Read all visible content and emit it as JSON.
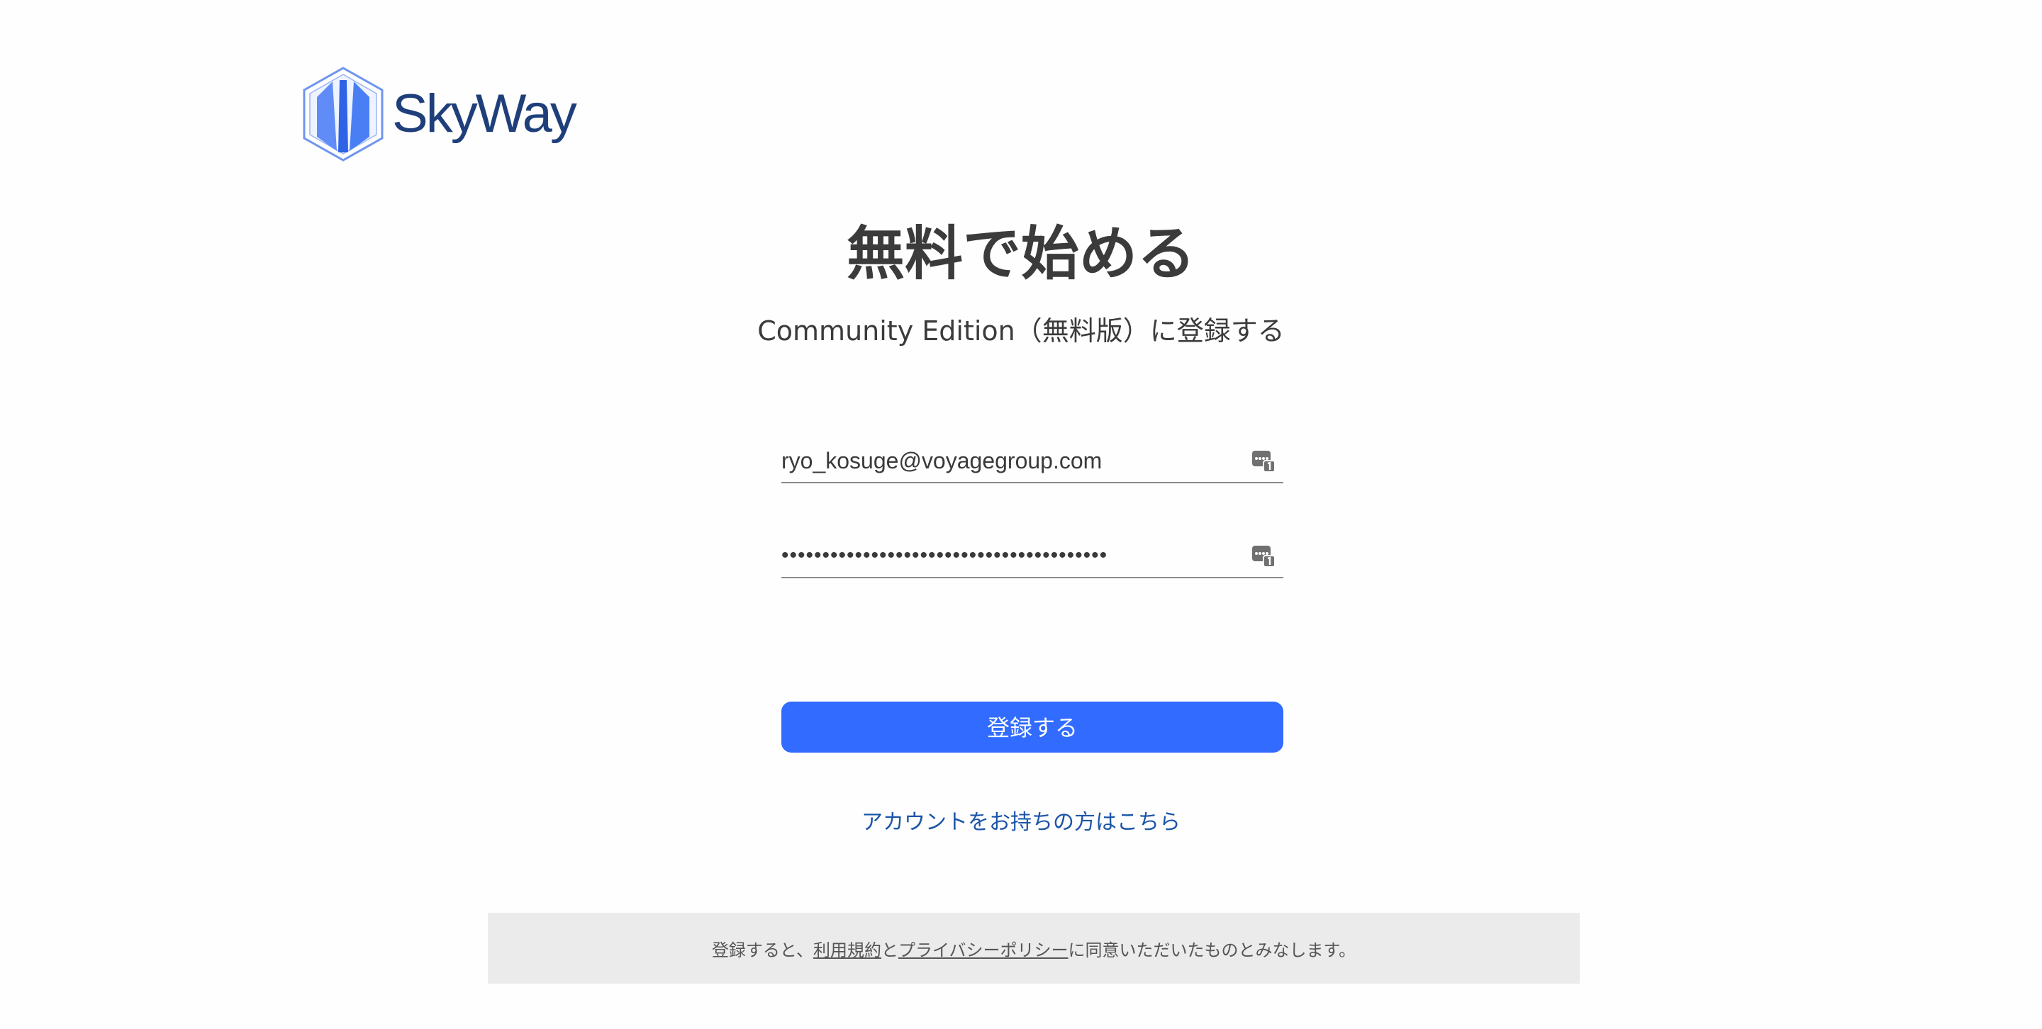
{
  "brand": {
    "logo_text": "SkyWay",
    "colors": {
      "logo_text": "#1f3f7a",
      "logo_hex": "#4a7ef5"
    }
  },
  "header": {
    "title": "無料で始める",
    "subtitle": "Community Edition（無料版）に登録する"
  },
  "form": {
    "email": {
      "value": "ryo_kosuge@voyagegroup.com",
      "icon": "password-manager-icon"
    },
    "password": {
      "value": "••••••••••••••••••••••••••••••••••••••••",
      "icon": "password-manager-icon"
    },
    "submit_label": "登録する",
    "submit_color": "#316bff"
  },
  "login_link": "アカウントをお持ちの方はこちら",
  "notice": {
    "prefix": "登録すると、",
    "terms_link": "利用規約",
    "and": "と",
    "privacy_link": "プライバシーポリシー",
    "suffix": "に同意いただいたものとみなします。"
  }
}
